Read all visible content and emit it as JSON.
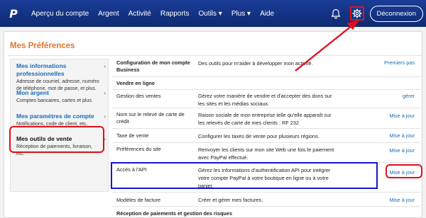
{
  "nav": {
    "logo": "P",
    "items": [
      "Aperçu du compte",
      "Argent",
      "Activité",
      "Rapports",
      "Outils ▾",
      "Plus ▾",
      "Aide"
    ],
    "logout": "Déconnexion"
  },
  "page_title": "Mes Préférences",
  "sidebar": [
    {
      "title": "Mes informations professionnelles",
      "desc": "Adresse de courriel, adresse, numéro de téléphone, mot de passe, et plus."
    },
    {
      "title": "Mon argent",
      "desc": "Comptes bancaires, cartes et plus."
    },
    {
      "title": "Mes paramètres de compte",
      "desc": "Notifications, code de client, etc."
    },
    {
      "title": "Mes outils de vente",
      "desc": "Réception de paiements, livraison, etc."
    }
  ],
  "rows": [
    {
      "name": "Configuration de mon compte Business",
      "desc": "Des outils pour m'aider à développer mon activité.",
      "action": "Premiers pas"
    },
    {
      "name": "Gestion des ventes",
      "desc": "Gérez votre manière de vendre et d'accepter des dons sur les sites et les médias sociaux.",
      "action": "gérer"
    },
    {
      "name": "Nom sur le relevé de carte de crédit",
      "desc": "Raison sociale de mon entreprise telle qu'elle apparaît sur les relevés de carte de mes clients : RF 232",
      "action": "Mise à jour"
    },
    {
      "name": "Taxe de vente",
      "desc": "Configurer les taxes de vente pour plusieurs régions.",
      "action": "Mise à jour"
    },
    {
      "name": "Préférences du site",
      "desc": "Renvoyer les clients sur mon site Web une fois le paiement avec PayPal effectué.",
      "action": "Mise à jour"
    },
    {
      "name": "Accès à l'API",
      "desc": "Gérez les informations d'authentification API pour intégrer votre compte PayPal à votre boutique en ligne ou à votre panier.",
      "action": "Mise à jour"
    },
    {
      "name": "Modèles de facture",
      "desc": "Créer et gérer mes factures.",
      "action": "Mise à jour"
    }
  ],
  "sections": {
    "online": "Vendre en ligne",
    "payments": "Réception de paiements et gestion des risques"
  },
  "colors": {
    "nav_bg": "#0f2b7a",
    "accent_orange": "#e0762a",
    "link_blue": "#1c6bb5",
    "highlight_red": "#e0101a",
    "highlight_blue": "#1515d4"
  }
}
